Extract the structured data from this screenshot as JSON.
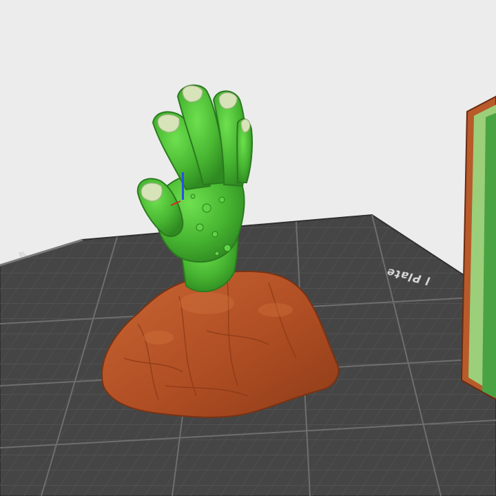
{
  "viewport": {
    "plate_label": "l Plate",
    "brand_mark": "BL",
    "background_color": "#ececec",
    "plate_color": "#444444",
    "grid_color": "#5c5c5c",
    "model_colors": {
      "hand": "#4fc43a",
      "base": "#b9562a",
      "nails": "#d7e3b8"
    },
    "side_object_colors": [
      "#b85a2a",
      "#9ccf79",
      "#4aa343"
    ]
  }
}
